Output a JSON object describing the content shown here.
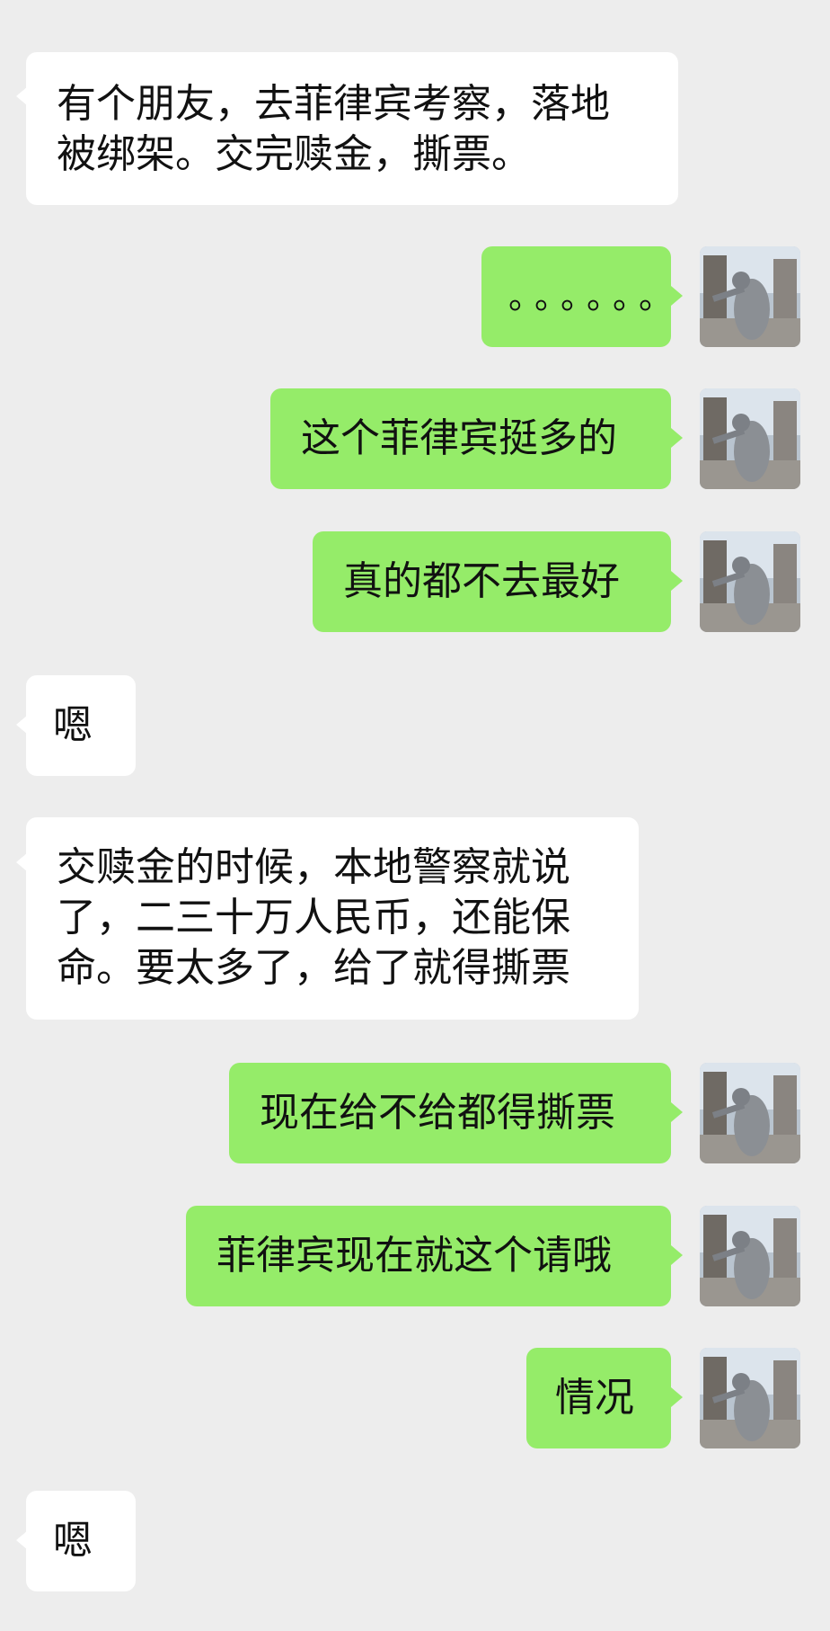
{
  "messages": [
    {
      "side": "left",
      "text": "有个朋友，去菲律宾考察，落地\n被绑架。交完赎金，撕票。"
    },
    {
      "side": "right",
      "text": "。。。。。。"
    },
    {
      "side": "right",
      "text": "这个菲律宾挺多的"
    },
    {
      "side": "right",
      "text": "真的都不去最好"
    },
    {
      "side": "left",
      "text": "嗯"
    },
    {
      "side": "left",
      "text": "交赎金的时候，本地警察就说\n了，二三十万人民币，还能保\n命。要太多了，给了就得撕票"
    },
    {
      "side": "right",
      "text": "现在给不给都得撕票"
    },
    {
      "side": "right",
      "text": "菲律宾现在就这个请哦"
    },
    {
      "side": "right",
      "text": "情况"
    },
    {
      "side": "left",
      "text": "嗯"
    }
  ],
  "colors": {
    "background": "#ededed",
    "incoming_bubble": "#ffffff",
    "outgoing_bubble": "#95ec69",
    "text": "#111111"
  },
  "icons": {
    "avatar": "user-avatar-photo-icon"
  }
}
